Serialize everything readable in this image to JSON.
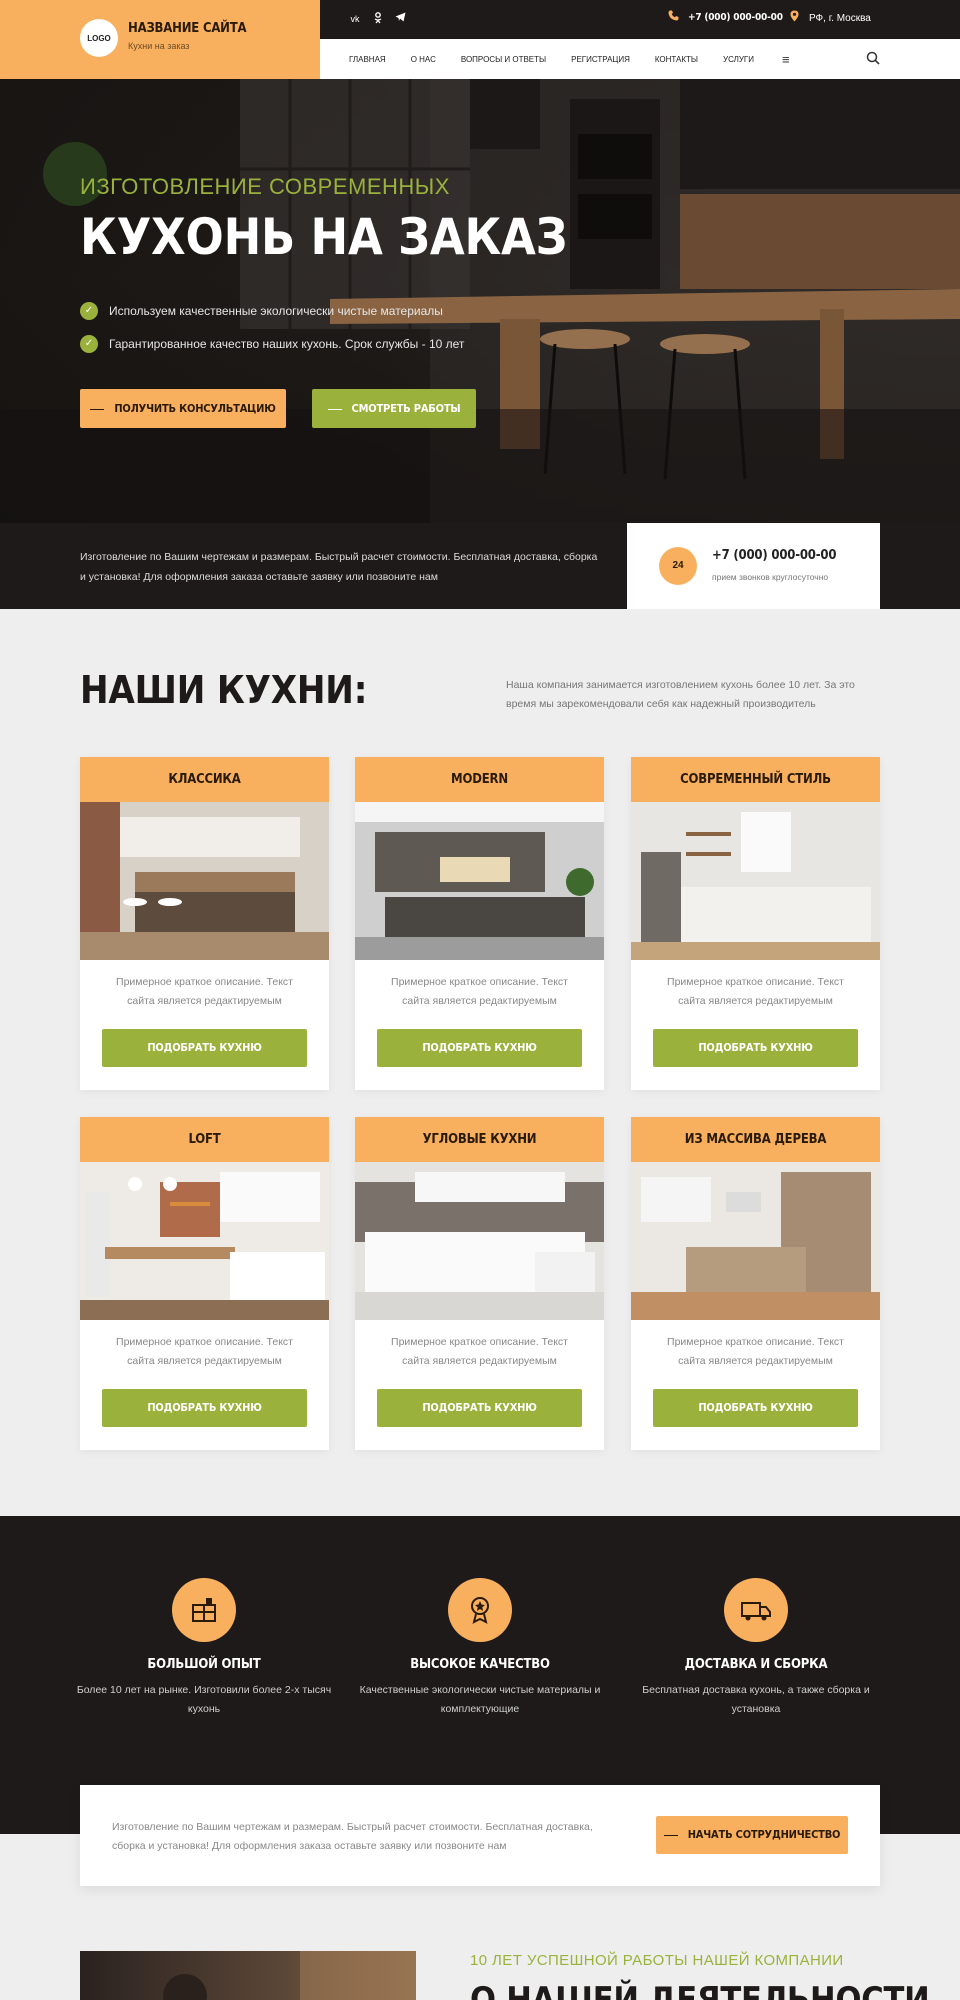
{
  "brand": {
    "logo": "LOGO",
    "name": "НАЗВАНИЕ САЙТА",
    "tagline": "Кухни на заказ",
    "accent": "#f9b05e",
    "green": "#9ab23b",
    "dark": "#1d1a19"
  },
  "topbar": {
    "socials": [
      "vk-icon",
      "ok-icon",
      "telegram-icon"
    ],
    "phone": "+7 (000) 000-00-00",
    "location": "РФ, г. Москва"
  },
  "nav": {
    "items": [
      "ГЛАВНАЯ",
      "О НАС",
      "ВОПРОСЫ И ОТВЕТЫ",
      "РЕГИСТРАЦИЯ",
      "КОНТАКТЫ",
      "УСЛУГИ"
    ],
    "menu_icon": "≡"
  },
  "hero": {
    "kicker": "ИЗГОТОВЛЕНИЕ СОВРЕМЕННЫХ",
    "title": "КУХОНЬ НА ЗАКАЗ",
    "features": [
      "Используем качественные экологически чистые материалы",
      "Гарантированное качество наших кухонь. Срок службы - 10 лет"
    ],
    "btn_consult": "ПОЛУЧИТЬ КОНСУЛЬТАЦИЮ",
    "btn_works": "СМОТРЕТЬ РАБОТЫ"
  },
  "strip": {
    "text": "Изготовление по Вашим чертежам и размерам. Быстрый расчет стоимости. Бесплатная доставка, сборка и установка! Для оформления заказа оставьте заявку или позвоните нам",
    "phone": "+7 (000) 000-00-00",
    "phone_note": "прием звонков круглосуточно",
    "icon_label": "24"
  },
  "kitchens": {
    "title": "НАШИ КУХНИ:",
    "desc": "Наша компания занимается изготовлением кухонь более 10 лет. За это время мы зарекомендовали себя как надежный производитель",
    "cards": [
      {
        "title": "КЛАССИКА",
        "desc": "Примерное краткое описание. Текст сайта является редактируемым",
        "btn": "ПОДОБРАТЬ КУХНЮ"
      },
      {
        "title": "MODERN",
        "desc": "Примерное краткое описание. Текст сайта является редактируемым",
        "btn": "ПОДОБРАТЬ КУХНЮ"
      },
      {
        "title": "СОВРЕМЕННЫЙ СТИЛЬ",
        "desc": "Примерное краткое описание. Текст сайта является редактируемым",
        "btn": "ПОДОБРАТЬ КУХНЮ"
      },
      {
        "title": "LOFT",
        "desc": "Примерное краткое описание. Текст сайта является редактируемым",
        "btn": "ПОДОБРАТЬ КУХНЮ"
      },
      {
        "title": "УГЛОВЫЕ КУХНИ",
        "desc": "Примерное краткое описание. Текст сайта является редактируемым",
        "btn": "ПОДОБРАТЬ КУХНЮ"
      },
      {
        "title": "ИЗ МАССИВА ДЕРЕВА",
        "desc": "Примерное краткое описание. Текст сайта является редактируемым",
        "btn": "ПОДОБРАТЬ КУХНЮ"
      }
    ]
  },
  "features": [
    {
      "icon": "kitchen-icon",
      "title": "БОЛЬШОЙ ОПЫТ",
      "text": "Более 10 лет на рынке. Изготовили более 2-х тысяч кухонь"
    },
    {
      "icon": "award-icon",
      "title": "ВЫСОКОЕ КАЧЕСТВО",
      "text": "Качественные экологически чистые материалы и комплектующие"
    },
    {
      "icon": "delivery-icon",
      "title": "ДОСТАВКА И СБОРКА",
      "text": "Бесплатная доставка кухонь, а также сборка и установка"
    }
  ],
  "cta": {
    "text": "Изготовление по Вашим чертежам и размерам. Быстрый расчет стоимости. Бесплатная доставка, сборка и установка! Для оформления заказа оставьте заявку или позвоните нам",
    "btn": "НАЧАТЬ СОТРУДНИЧЕСТВО"
  },
  "about": {
    "kicker": "10 ЛЕТ УСПЕШНОЙ РАБОТЫ НАШЕЙ КОМПАНИИ",
    "title": "О НАШЕЙ ДЕЯТЕЛЬНОСТИ"
  }
}
